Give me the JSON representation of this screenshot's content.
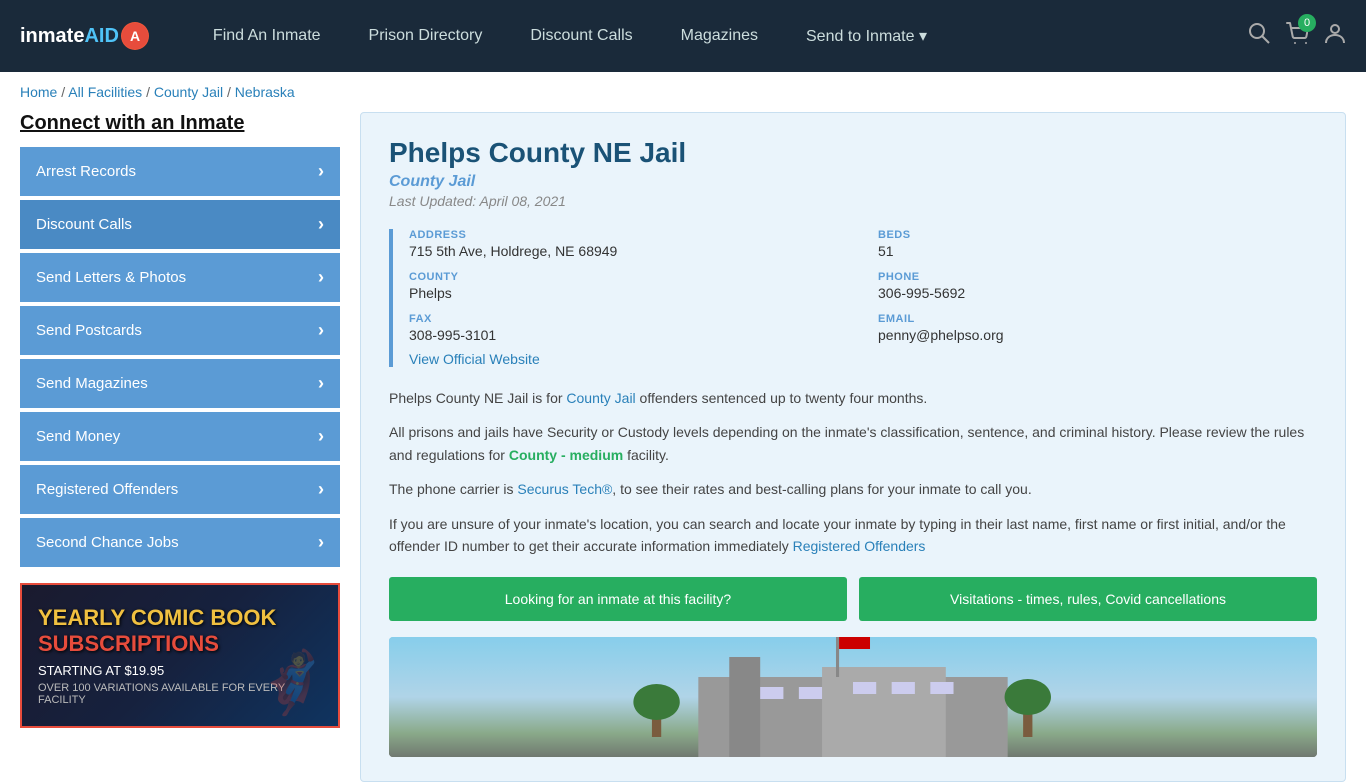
{
  "nav": {
    "logo_text": "inmateAID",
    "links": [
      {
        "label": "Find An Inmate",
        "id": "find-an-inmate"
      },
      {
        "label": "Prison Directory",
        "id": "prison-directory"
      },
      {
        "label": "Discount Calls",
        "id": "discount-calls"
      },
      {
        "label": "Magazines",
        "id": "magazines"
      },
      {
        "label": "Send to Inmate ▾",
        "id": "send-to-inmate"
      }
    ],
    "cart_count": "0"
  },
  "breadcrumb": {
    "home": "Home",
    "all_facilities": "All Facilities",
    "county_jail": "County Jail",
    "state": "Nebraska"
  },
  "sidebar": {
    "title": "Connect with an Inmate",
    "items": [
      {
        "label": "Arrest Records",
        "id": "arrest-records"
      },
      {
        "label": "Discount Calls",
        "id": "discount-calls"
      },
      {
        "label": "Send Letters & Photos",
        "id": "send-letters-photos"
      },
      {
        "label": "Send Postcards",
        "id": "send-postcards"
      },
      {
        "label": "Send Magazines",
        "id": "send-magazines"
      },
      {
        "label": "Send Money",
        "id": "send-money"
      },
      {
        "label": "Registered Offenders",
        "id": "registered-offenders"
      },
      {
        "label": "Second Chance Jobs",
        "id": "second-chance-jobs"
      }
    ],
    "ad": {
      "line1": "YEARLY COMIC BOOK",
      "line2": "SUBSCRIPTIONS",
      "price": "STARTING AT $19.95",
      "footer": "OVER 100 VARIATIONS AVAILABLE FOR EVERY FACILITY"
    }
  },
  "facility": {
    "name": "Phelps County NE Jail",
    "type": "County Jail",
    "last_updated": "Last Updated: April 08, 2021",
    "address_label": "ADDRESS",
    "address_value": "715 5th Ave, Holdrege, NE 68949",
    "beds_label": "BEDS",
    "beds_value": "51",
    "county_label": "COUNTY",
    "county_value": "Phelps",
    "phone_label": "PHONE",
    "phone_value": "306-995-5692",
    "fax_label": "FAX",
    "fax_value": "308-995-3101",
    "email_label": "EMAIL",
    "email_value": "penny@phelpso.org",
    "website_link": "View Official Website",
    "desc1": "Phelps County NE Jail is for County Jail offenders sentenced up to twenty four months.",
    "desc2": "All prisons and jails have Security or Custody levels depending on the inmate's classification, sentence, and criminal history. Please review the rules and regulations for County - medium facility.",
    "desc3": "The phone carrier is Securus Tech®, to see their rates and best-calling plans for your inmate to call you.",
    "desc4": "If you are unsure of your inmate's location, you can search and locate your inmate by typing in their last name, first name or first initial, and/or the offender ID number to get their accurate information immediately Registered Offenders",
    "btn1": "Looking for an inmate at this facility?",
    "btn2": "Visitations - times, rules, Covid cancellations"
  }
}
